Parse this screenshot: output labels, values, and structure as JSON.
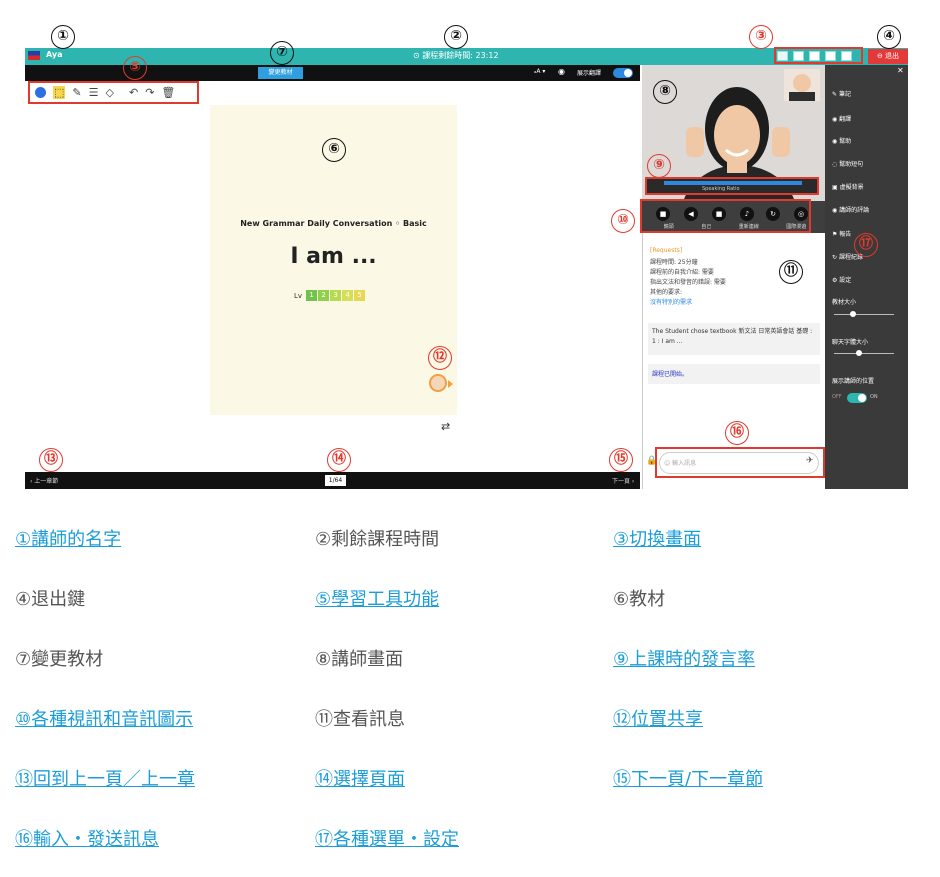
{
  "app": {
    "teacher_name": "Aya",
    "timer": "⊙ 課程剩餘時間: 23:12",
    "exit": "⊖ 退出",
    "change_material": "變更教材",
    "font_size": "ₐA ▾",
    "show_teacher": "展示翻譯"
  },
  "material": {
    "subtitle": "New Grammar  Daily Conversation ◦ Basic",
    "title": "I am ...",
    "lv_label": "Lv",
    "levels": [
      "1",
      "2",
      "3",
      "4",
      "5"
    ]
  },
  "nav": {
    "prev": "‹ 上一章節",
    "next": "下一頁 ›",
    "page": "1/64"
  },
  "video": {
    "speaking": "Speaking Ratio"
  },
  "controls": [
    "鏡頭",
    "",
    "自己",
    "",
    "重新連線",
    "國際漫遊"
  ],
  "messages": {
    "header": "[Requests]",
    "lines": [
      "課程時間: 25分鐘",
      "課程前的自我介紹: 需要",
      "指出文法和發音的錯誤: 需要",
      "其他的要求:",
      "沒有特別的需求"
    ],
    "student": "The Student chose textbook 新文法 日常英語會話 基礎 : 1 : I am ...",
    "started": "課程已開始。",
    "input_placeholder": "輸入訊息"
  },
  "menu": {
    "items": [
      "筆記",
      "翻譯",
      "幫助",
      "幫助短句",
      "虛擬背景",
      "講師的評論",
      "報告",
      "課程紀錄",
      "設定"
    ],
    "material_size": "教材大小",
    "chat_size": "聊天字體大小",
    "show_position": "展示講師的位置",
    "off": "OFF",
    "on": "ON"
  },
  "markers": {
    "n1": "①",
    "n2": "②",
    "n3": "③",
    "n4": "④",
    "n5": "⑤",
    "n6": "⑥",
    "n7": "⑦",
    "n8": "⑧",
    "n9": "⑨",
    "n10": "⑩",
    "n11": "⑪",
    "n12": "⑫",
    "n13": "⑬",
    "n14": "⑭",
    "n15": "⑮",
    "n16": "⑯",
    "n17": "⑰"
  },
  "captions": [
    "①講師的名字",
    "②剩餘課程時間",
    "③切換畫面",
    "④退出鍵",
    "⑤學習工具功能",
    "⑥教材",
    "⑦變更教材",
    "⑧講師畫面",
    "⑨上課時的發言率",
    "⑩各種視訊和音訊圖示",
    "⑪查看訊息",
    "⑫位置共享",
    "⑬回到上一頁／上一章",
    "⑭選擇頁面",
    "⑮下一頁/下一章節",
    "⑯輸入・發送訊息",
    "⑰各種選單・設定"
  ],
  "colors": {
    "teal": "#2eb5b0",
    "red": "#e03a2e",
    "link": "#1b9ed8"
  }
}
